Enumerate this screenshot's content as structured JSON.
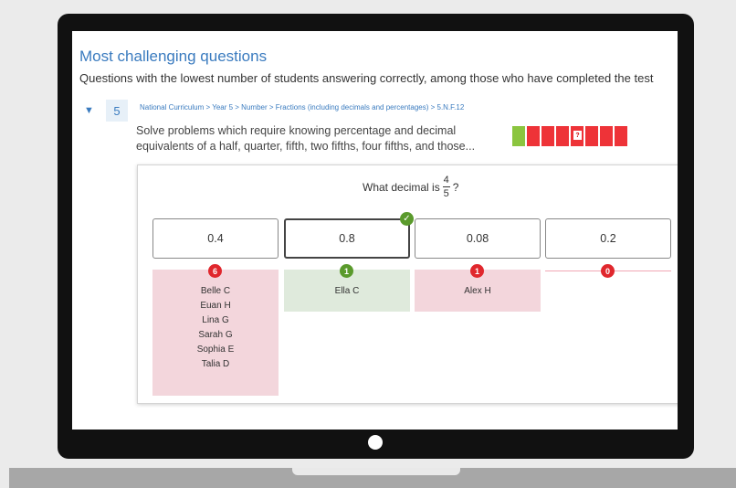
{
  "report": {
    "title": "Most challenging questions",
    "subtitle": "Questions with the lowest number of students answering correctly, among those who have completed the test"
  },
  "question": {
    "toggle_icon": "▼",
    "number": "5",
    "breadcrumb": "National Curriculum > Year 5 > Number > Fractions (including decimals and percentages) > 5.N.F.12",
    "description_line1": "Solve problems which require knowing percentage and decimal",
    "description_line2": "equivalents of a half, quarter, fifth, two fifths, four fifths, and those...",
    "heatmap": {
      "cells": [
        "correct",
        "wrong",
        "wrong",
        "wrong",
        "unknown",
        "wrong",
        "wrong",
        "wrong"
      ],
      "unknown_label": "?",
      "colors": {
        "correct": "#8bc53f",
        "wrong": "#ee3338"
      }
    },
    "prompt_prefix": "What decimal is",
    "prompt_numerator": "4",
    "prompt_denominator": "5",
    "prompt_suffix": "?",
    "answers": [
      {
        "label": "0.4",
        "count": "6",
        "correct": false,
        "students": [
          "Belle C",
          "Euan H",
          "Lina G",
          "Sarah G",
          "Sophia E",
          "Talia D"
        ]
      },
      {
        "label": "0.8",
        "count": "1",
        "correct": true,
        "students": [
          "Ella C"
        ]
      },
      {
        "label": "0.08",
        "count": "1",
        "correct": false,
        "students": [
          "Alex H"
        ]
      },
      {
        "label": "0.2",
        "count": "0",
        "correct": false,
        "students": []
      }
    ],
    "check_icon": "✓"
  }
}
